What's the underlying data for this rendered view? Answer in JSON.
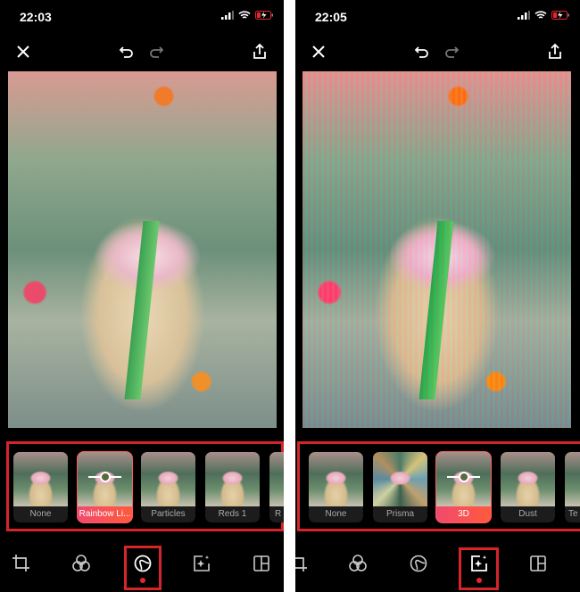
{
  "screens": [
    {
      "status": {
        "time": "22:03",
        "battery_color": "#e8262d"
      },
      "top_bar": {
        "close_icon": "close-icon",
        "undo_icon": "undo-icon",
        "redo_icon": "redo-icon",
        "share_icon": "share-icon"
      },
      "effects": [
        {
          "label": "None",
          "selected": false
        },
        {
          "label": "Rainbow Li...",
          "selected": true
        },
        {
          "label": "Particles",
          "selected": false
        },
        {
          "label": "Reds 1",
          "selected": false
        },
        {
          "label": "R",
          "selected": false
        }
      ],
      "toolbar": {
        "active": "effects-curve",
        "icons": [
          "crop-icon",
          "filters-icon",
          "effects-curve-icon",
          "magic-sparkle-icon",
          "layout-icon"
        ]
      }
    },
    {
      "status": {
        "time": "22:05",
        "battery_color": "#e8262d"
      },
      "top_bar": {
        "close_icon": "close-icon",
        "undo_icon": "undo-icon",
        "redo_icon": "redo-icon",
        "share_icon": "share-icon"
      },
      "effects": [
        {
          "label": "None",
          "selected": false
        },
        {
          "label": "Prisma",
          "selected": false
        },
        {
          "label": "3D",
          "selected": true
        },
        {
          "label": "Dust",
          "selected": false
        },
        {
          "label": "Te",
          "selected": false
        }
      ],
      "toolbar": {
        "active": "magic-sparkle",
        "icons": [
          "crop-icon",
          "filters-icon",
          "effects-curve-icon",
          "magic-sparkle-icon",
          "layout-icon"
        ]
      }
    }
  ],
  "colors": {
    "accent": "#ff5a5f",
    "highlight_box": "#d6242b",
    "active_dot": "#e8262d"
  }
}
